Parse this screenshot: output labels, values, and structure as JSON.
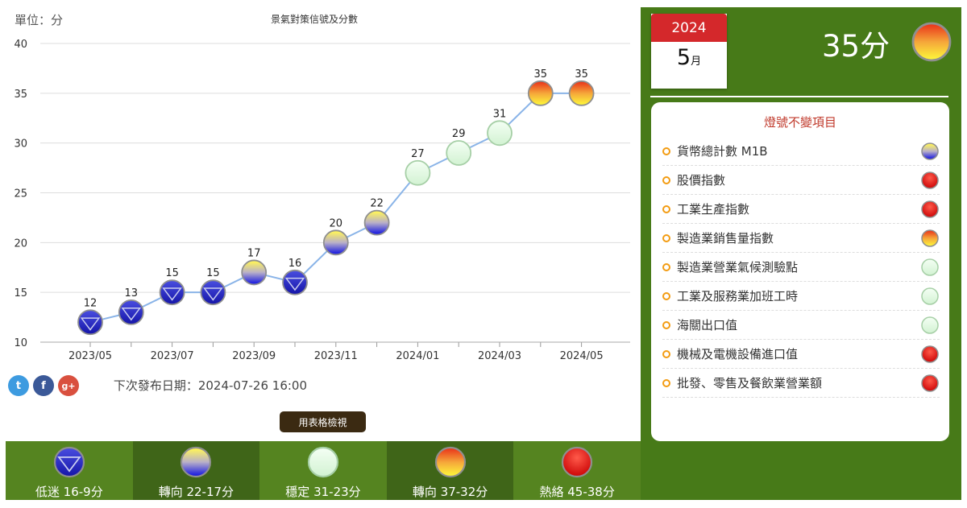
{
  "unit_label": "單位：分",
  "chart_data": {
    "type": "line",
    "title": "景氣對策信號及分數",
    "ylabel": "單位：分",
    "ylim": [
      10,
      40
    ],
    "yticks": [
      10,
      15,
      20,
      25,
      30,
      35,
      40
    ],
    "grid": true,
    "categories": [
      "2023/05",
      "2023/06",
      "2023/07",
      "2023/08",
      "2023/09",
      "2023/10",
      "2023/11",
      "2023/12",
      "2024/01",
      "2024/02",
      "2024/03",
      "2024/04",
      "2024/05"
    ],
    "xtick_labels": [
      "2023/05",
      "2023/07",
      "2023/09",
      "2023/11",
      "2024/01",
      "2024/03",
      "2024/05"
    ],
    "values": [
      12,
      13,
      15,
      15,
      17,
      16,
      20,
      22,
      27,
      29,
      31,
      35,
      35
    ],
    "signals": [
      "blue",
      "blue",
      "blue",
      "blue",
      "yellow-blue",
      "blue",
      "yellow-blue",
      "yellow-blue",
      "green",
      "green",
      "green",
      "yellow-red",
      "yellow-red"
    ]
  },
  "next_release": "下次發布日期：2024-07-26 16:00",
  "table_button": "用表格檢視",
  "social": {
    "twitter": "t",
    "facebook": "f",
    "google": "g+"
  },
  "legend": [
    {
      "label": "低迷 16-9分",
      "signal": "blue"
    },
    {
      "label": "轉向 22-17分",
      "signal": "yellow-blue"
    },
    {
      "label": "穩定 31-23分",
      "signal": "green"
    },
    {
      "label": "轉向 37-32分",
      "signal": "yellow-red"
    },
    {
      "label": "熱絡 45-38分",
      "signal": "red"
    }
  ],
  "side": {
    "year": "2024",
    "month": "5",
    "month_unit": "月",
    "score": "35分",
    "score_signal": "yellow-red",
    "panel_title": "燈號不變項目",
    "items": [
      {
        "label": "貨幣總計數 M1B",
        "signal": "yellow-blue"
      },
      {
        "label": "股價指數",
        "signal": "red"
      },
      {
        "label": "工業生產指數",
        "signal": "red"
      },
      {
        "label": "製造業銷售量指數",
        "signal": "yellow-red"
      },
      {
        "label": "製造業營業氣候測驗點",
        "signal": "green"
      },
      {
        "label": "工業及服務業加班工時",
        "signal": "green"
      },
      {
        "label": "海關出口值",
        "signal": "green"
      },
      {
        "label": "機械及電機設備進口值",
        "signal": "red"
      },
      {
        "label": "批發、零售及餐飲業營業額",
        "signal": "red"
      }
    ]
  },
  "colors": {
    "line": "#8ab4e8",
    "grid": "#dddddd",
    "side_bg": "#477a18",
    "calendar_red": "#d4282b",
    "panel_title": "#c0392b"
  }
}
